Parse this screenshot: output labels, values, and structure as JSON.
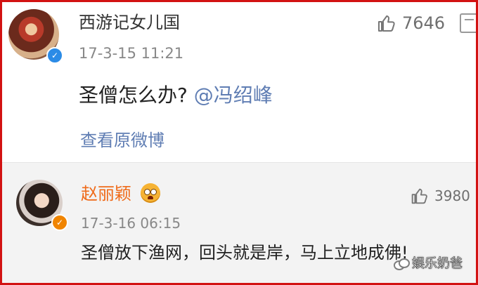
{
  "post": {
    "username": "西游记女儿国",
    "timestamp": "17-3-15 11:21",
    "text_before": "圣僧怎么办?",
    "mention": "@冯绍峰",
    "view_original_link": "查看原微博",
    "like_count": "7646",
    "avatar_icon": "user-avatar",
    "verified_badge": "✓",
    "like_icon": "thumbs-up-icon",
    "more_icon": "share-icon"
  },
  "reply": {
    "username": "赵丽颖",
    "emoji": "shocked-face-emoji",
    "timestamp": "17-3-16 06:15",
    "text": "圣僧放下渔网，回头就是岸，马上立地成佛!",
    "like_count": "3980",
    "verified_badge": "✓",
    "like_icon": "thumbs-up-icon"
  },
  "watermark": {
    "text": "娱乐奶爸"
  },
  "colors": {
    "border": "#d21212",
    "mention": "#5f7db3",
    "reply_name": "#ef6b1a",
    "reply_background": "#f3f3f3",
    "verified_blue": "#2b8be6",
    "verified_orange": "#f08400"
  }
}
